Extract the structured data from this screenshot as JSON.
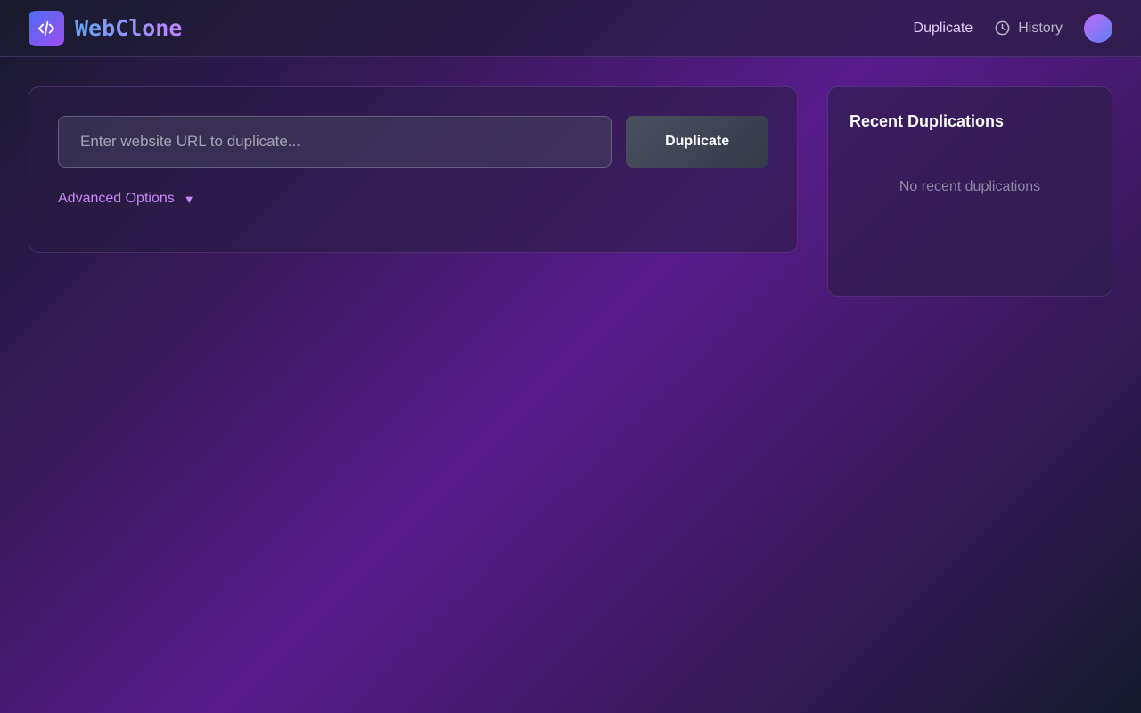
{
  "header": {
    "brand_name": "WebClone",
    "logo_icon": "code-icon",
    "nav": {
      "duplicate_label": "Duplicate",
      "history_label": "History"
    }
  },
  "main": {
    "url_placeholder": "Enter website URL to duplicate...",
    "url_value": "",
    "duplicate_button_label": "Duplicate",
    "advanced_options_label": "Advanced Options",
    "advanced_chevron": "▼"
  },
  "sidebar": {
    "title": "Recent Duplications",
    "empty_text": "No recent duplications"
  },
  "colors": {
    "accent_purple": "#c88af5",
    "brand_gradient_start": "#60a5fa",
    "brand_gradient_end": "#c084fc"
  }
}
